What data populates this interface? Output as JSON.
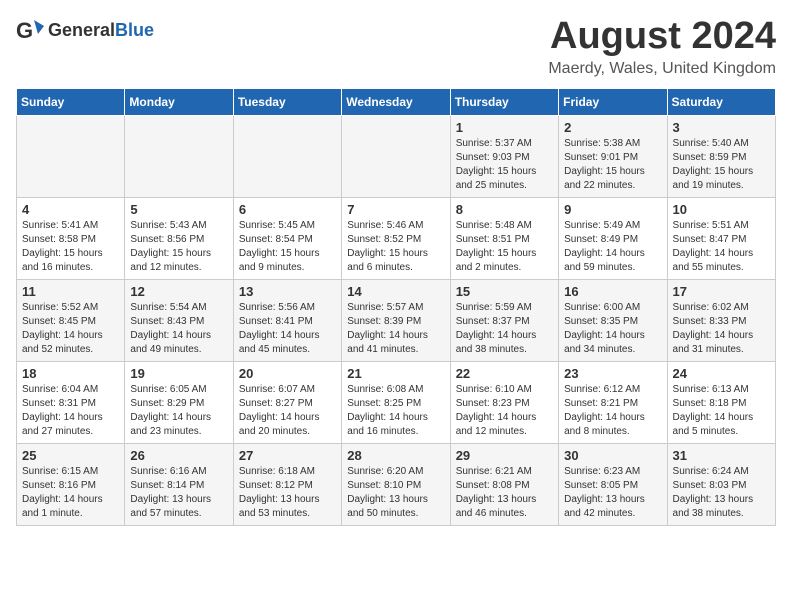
{
  "header": {
    "logo_general": "General",
    "logo_blue": "Blue",
    "month_title": "August 2024",
    "location": "Maerdy, Wales, United Kingdom"
  },
  "days_of_week": [
    "Sunday",
    "Monday",
    "Tuesday",
    "Wednesday",
    "Thursday",
    "Friday",
    "Saturday"
  ],
  "weeks": [
    [
      {
        "day": "",
        "info": ""
      },
      {
        "day": "",
        "info": ""
      },
      {
        "day": "",
        "info": ""
      },
      {
        "day": "",
        "info": ""
      },
      {
        "day": "1",
        "info": "Sunrise: 5:37 AM\nSunset: 9:03 PM\nDaylight: 15 hours\nand 25 minutes."
      },
      {
        "day": "2",
        "info": "Sunrise: 5:38 AM\nSunset: 9:01 PM\nDaylight: 15 hours\nand 22 minutes."
      },
      {
        "day": "3",
        "info": "Sunrise: 5:40 AM\nSunset: 8:59 PM\nDaylight: 15 hours\nand 19 minutes."
      }
    ],
    [
      {
        "day": "4",
        "info": "Sunrise: 5:41 AM\nSunset: 8:58 PM\nDaylight: 15 hours\nand 16 minutes."
      },
      {
        "day": "5",
        "info": "Sunrise: 5:43 AM\nSunset: 8:56 PM\nDaylight: 15 hours\nand 12 minutes."
      },
      {
        "day": "6",
        "info": "Sunrise: 5:45 AM\nSunset: 8:54 PM\nDaylight: 15 hours\nand 9 minutes."
      },
      {
        "day": "7",
        "info": "Sunrise: 5:46 AM\nSunset: 8:52 PM\nDaylight: 15 hours\nand 6 minutes."
      },
      {
        "day": "8",
        "info": "Sunrise: 5:48 AM\nSunset: 8:51 PM\nDaylight: 15 hours\nand 2 minutes."
      },
      {
        "day": "9",
        "info": "Sunrise: 5:49 AM\nSunset: 8:49 PM\nDaylight: 14 hours\nand 59 minutes."
      },
      {
        "day": "10",
        "info": "Sunrise: 5:51 AM\nSunset: 8:47 PM\nDaylight: 14 hours\nand 55 minutes."
      }
    ],
    [
      {
        "day": "11",
        "info": "Sunrise: 5:52 AM\nSunset: 8:45 PM\nDaylight: 14 hours\nand 52 minutes."
      },
      {
        "day": "12",
        "info": "Sunrise: 5:54 AM\nSunset: 8:43 PM\nDaylight: 14 hours\nand 49 minutes."
      },
      {
        "day": "13",
        "info": "Sunrise: 5:56 AM\nSunset: 8:41 PM\nDaylight: 14 hours\nand 45 minutes."
      },
      {
        "day": "14",
        "info": "Sunrise: 5:57 AM\nSunset: 8:39 PM\nDaylight: 14 hours\nand 41 minutes."
      },
      {
        "day": "15",
        "info": "Sunrise: 5:59 AM\nSunset: 8:37 PM\nDaylight: 14 hours\nand 38 minutes."
      },
      {
        "day": "16",
        "info": "Sunrise: 6:00 AM\nSunset: 8:35 PM\nDaylight: 14 hours\nand 34 minutes."
      },
      {
        "day": "17",
        "info": "Sunrise: 6:02 AM\nSunset: 8:33 PM\nDaylight: 14 hours\nand 31 minutes."
      }
    ],
    [
      {
        "day": "18",
        "info": "Sunrise: 6:04 AM\nSunset: 8:31 PM\nDaylight: 14 hours\nand 27 minutes."
      },
      {
        "day": "19",
        "info": "Sunrise: 6:05 AM\nSunset: 8:29 PM\nDaylight: 14 hours\nand 23 minutes."
      },
      {
        "day": "20",
        "info": "Sunrise: 6:07 AM\nSunset: 8:27 PM\nDaylight: 14 hours\nand 20 minutes."
      },
      {
        "day": "21",
        "info": "Sunrise: 6:08 AM\nSunset: 8:25 PM\nDaylight: 14 hours\nand 16 minutes."
      },
      {
        "day": "22",
        "info": "Sunrise: 6:10 AM\nSunset: 8:23 PM\nDaylight: 14 hours\nand 12 minutes."
      },
      {
        "day": "23",
        "info": "Sunrise: 6:12 AM\nSunset: 8:21 PM\nDaylight: 14 hours\nand 8 minutes."
      },
      {
        "day": "24",
        "info": "Sunrise: 6:13 AM\nSunset: 8:18 PM\nDaylight: 14 hours\nand 5 minutes."
      }
    ],
    [
      {
        "day": "25",
        "info": "Sunrise: 6:15 AM\nSunset: 8:16 PM\nDaylight: 14 hours\nand 1 minute."
      },
      {
        "day": "26",
        "info": "Sunrise: 6:16 AM\nSunset: 8:14 PM\nDaylight: 13 hours\nand 57 minutes."
      },
      {
        "day": "27",
        "info": "Sunrise: 6:18 AM\nSunset: 8:12 PM\nDaylight: 13 hours\nand 53 minutes."
      },
      {
        "day": "28",
        "info": "Sunrise: 6:20 AM\nSunset: 8:10 PM\nDaylight: 13 hours\nand 50 minutes."
      },
      {
        "day": "29",
        "info": "Sunrise: 6:21 AM\nSunset: 8:08 PM\nDaylight: 13 hours\nand 46 minutes."
      },
      {
        "day": "30",
        "info": "Sunrise: 6:23 AM\nSunset: 8:05 PM\nDaylight: 13 hours\nand 42 minutes."
      },
      {
        "day": "31",
        "info": "Sunrise: 6:24 AM\nSunset: 8:03 PM\nDaylight: 13 hours\nand 38 minutes."
      }
    ]
  ]
}
